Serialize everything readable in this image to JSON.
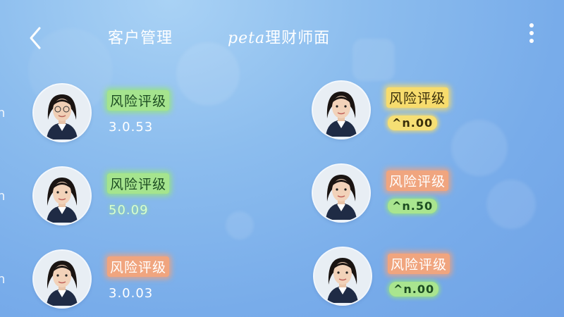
{
  "header": {
    "back_icon": "chevron-left-icon",
    "title_left": "客户管理",
    "title_center_script": "peta",
    "title_center_text": "理财师面",
    "more_icon": "vertical-dots-icon"
  },
  "edge_marks": [
    "n",
    "n",
    "n"
  ],
  "customers": [
    {
      "risk_label": "风险评级",
      "value": "3.0.53",
      "label_color": "#a5e48e"
    },
    {
      "risk_label": "风险评级",
      "value": "^n.00",
      "label_color": "#f7dc6d"
    },
    {
      "risk_label": "风险评级",
      "value": "50.09",
      "label_color": "#a5e48e"
    },
    {
      "risk_label": "风险评级",
      "value": "^n.50",
      "label_color": "#f0a57f"
    },
    {
      "risk_label": "风险评级",
      "value": "3.0.03",
      "label_color": "#f0a57f"
    },
    {
      "risk_label": "风险评级",
      "value": "^n.00",
      "label_color": "#f0a57f"
    }
  ]
}
